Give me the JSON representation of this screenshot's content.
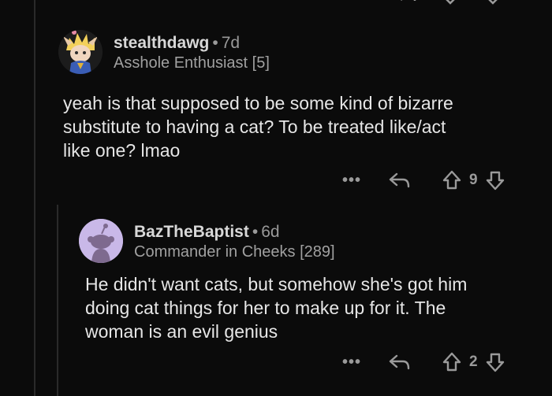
{
  "comments": [
    {
      "username": "stealthdawg",
      "separator": "•",
      "age": "7d",
      "flair": "Asshole Enthusiast [5]",
      "body": "yeah is that supposed to be some kind of bizarre\nsubstitute to having a cat? To be treated like/act\nlike one? lmao",
      "more_label": "•••",
      "score": "9"
    },
    {
      "username": "BazTheBaptist",
      "separator": "•",
      "age": "6d",
      "flair": "Commander in Cheeks [289]",
      "body": "He didn't want cats, but somehow she's got him\ndoing cat things for her to make up for it. The\nwoman is an evil genius",
      "more_label": "•••",
      "score": "2"
    }
  ],
  "icons": {
    "reply": "reply-arrow-icon",
    "upvote": "upvote-arrow-icon",
    "downvote": "downvote-arrow-icon",
    "more": "more-dots-icon"
  },
  "colors": {
    "background": "#0b0b0b",
    "avatar_2": "#c9b8e8"
  }
}
